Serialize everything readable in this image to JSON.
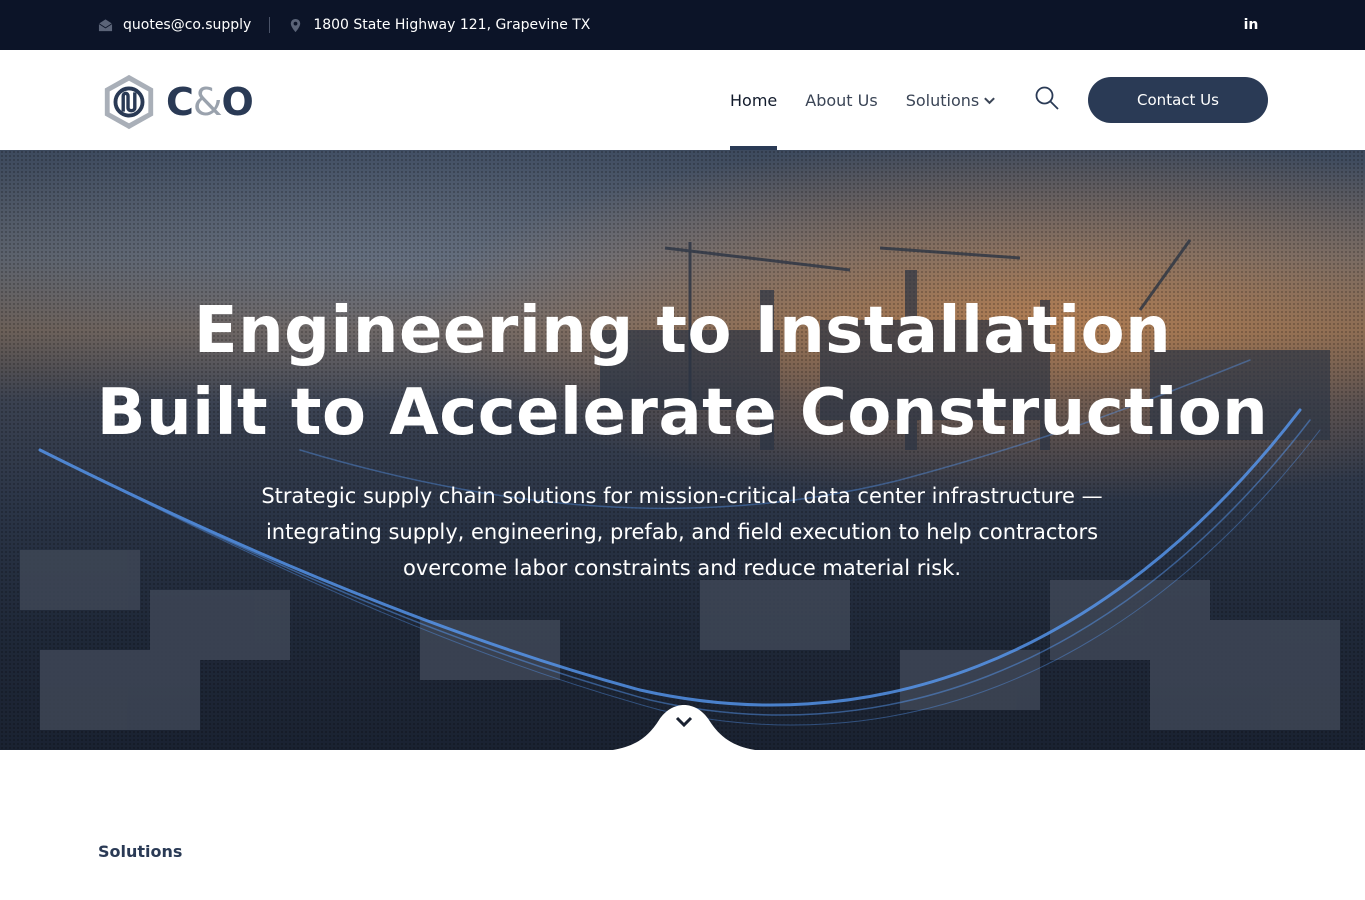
{
  "topbar": {
    "email": "quotes@co.supply",
    "address": "1800 State Highway 121, Grapevine TX",
    "linkedin_label": "in"
  },
  "header": {
    "logo_c": "C",
    "logo_amp": "&",
    "logo_o": "O",
    "nav": [
      {
        "label": "Home",
        "active": true
      },
      {
        "label": "About Us",
        "active": false
      },
      {
        "label": "Solutions",
        "active": false
      }
    ],
    "cta_label": "Contact Us"
  },
  "hero": {
    "title_line1": "Engineering to Installation",
    "title_line2": "Built to Accelerate Construction",
    "subtitle": "Strategic supply chain solutions for mission-critical data center infrastructure — integrating supply, engineering, prefab, and field execution to help contractors overcome labor constraints and reduce material risk."
  },
  "section": {
    "label": "Solutions"
  },
  "colors": {
    "topbar_bg": "#0c1428",
    "brand": "#2a3a55",
    "accent_glow": "#5aa0ff"
  },
  "icons": [
    "envelope-icon",
    "map-pin-icon",
    "linkedin-icon",
    "chevron-down-icon",
    "search-icon",
    "scroll-down-icon"
  ]
}
